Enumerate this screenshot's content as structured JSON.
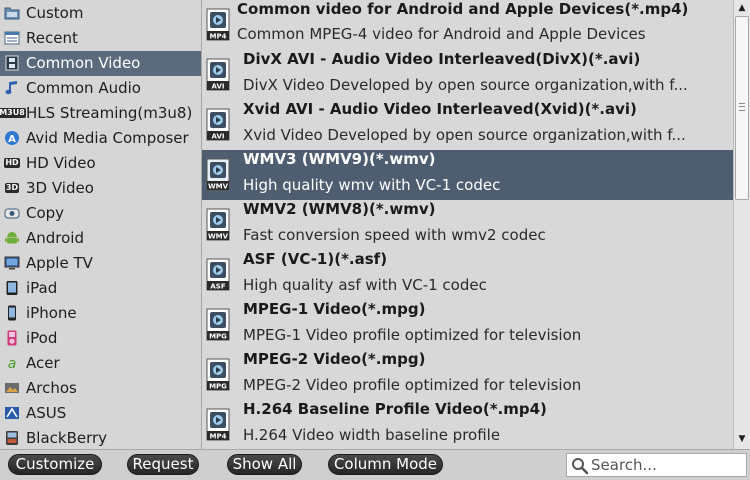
{
  "categories": [
    {
      "label": "Custom",
      "icon": "folder-icon"
    },
    {
      "label": "Recent",
      "icon": "list-icon"
    },
    {
      "label": "Common Video",
      "icon": "film-icon",
      "selected": true
    },
    {
      "label": "Common Audio",
      "icon": "music-note-icon"
    },
    {
      "label": "HLS Streaming(m3u8)",
      "icon": "hls-icon",
      "badge": "M3U8"
    },
    {
      "label": "Avid Media Composer",
      "icon": "avid-icon"
    },
    {
      "label": "HD Video",
      "icon": "hd-icon",
      "badge": "HD"
    },
    {
      "label": "3D Video",
      "icon": "3d-icon",
      "badge": "3D"
    },
    {
      "label": "Copy",
      "icon": "copy-icon"
    },
    {
      "label": "Android",
      "icon": "android-icon"
    },
    {
      "label": "Apple TV",
      "icon": "tv-icon"
    },
    {
      "label": "iPad",
      "icon": "ipad-icon"
    },
    {
      "label": "iPhone",
      "icon": "iphone-icon"
    },
    {
      "label": "iPod",
      "icon": "ipod-icon"
    },
    {
      "label": "Acer",
      "icon": "acer-icon"
    },
    {
      "label": "Archos",
      "icon": "archos-icon"
    },
    {
      "label": "ASUS",
      "icon": "asus-icon"
    },
    {
      "label": "BlackBerry",
      "icon": "blackberry-icon"
    }
  ],
  "formats": [
    {
      "title": "Common video for Android and Apple Devices(*.mp4)",
      "desc": "Common MPEG-4 video for Android and Apple Devices",
      "icon": "mp4-file-icon",
      "tag": "MP4"
    },
    {
      "title": "DivX AVI - Audio Video Interleaved(DivX)(*.avi)",
      "desc": "DivX Video Developed by open source organization,with f...",
      "icon": "avi-file-icon",
      "tag": "AVI"
    },
    {
      "title": "Xvid AVI - Audio Video Interleaved(Xvid)(*.avi)",
      "desc": "Xvid Video Developed by open source organization,with f...",
      "icon": "xvid-file-icon",
      "tag": "AVI"
    },
    {
      "title": "WMV3 (WMV9)(*.wmv)",
      "desc": "High quality wmv with VC-1 codec",
      "icon": "wmv-file-icon",
      "tag": "WMV",
      "selected": true
    },
    {
      "title": "WMV2 (WMV8)(*.wmv)",
      "desc": "Fast conversion speed with wmv2 codec",
      "icon": "wmv-file-icon",
      "tag": "WMV"
    },
    {
      "title": "ASF (VC-1)(*.asf)",
      "desc": "High quality asf with VC-1 codec",
      "icon": "asf-file-icon",
      "tag": "ASF"
    },
    {
      "title": "MPEG-1 Video(*.mpg)",
      "desc": "MPEG-1 Video profile optimized for television",
      "icon": "mpg-file-icon",
      "tag": "MPG"
    },
    {
      "title": "MPEG-2 Video(*.mpg)",
      "desc": "MPEG-2 Video profile optimized for television",
      "icon": "mpg-file-icon",
      "tag": "MPG"
    },
    {
      "title": "H.264 Baseline Profile Video(*.mp4)",
      "desc": "H.264 Video width baseline profile",
      "icon": "h264-file-icon",
      "tag": "MP4"
    }
  ],
  "toolbar": {
    "customize": "Customize",
    "request": "Request",
    "show_all": "Show All",
    "column_mode": "Column Mode"
  },
  "search": {
    "placeholder": "Search...",
    "value": ""
  },
  "scrollbar": {
    "up": "▲",
    "down": "▼"
  },
  "colors": {
    "selected_bg": "#4e5e70",
    "sidebar_selected_bg": "#5b6b7d",
    "button_bg": "#2f2f2f"
  }
}
